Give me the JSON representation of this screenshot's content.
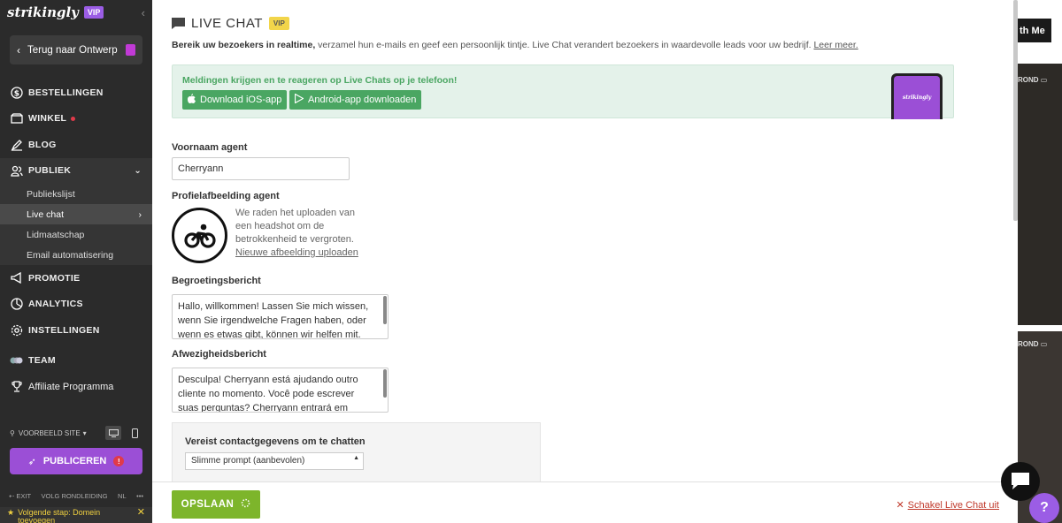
{
  "sidebar": {
    "logo": "strikingly",
    "vip_badge": "VIP",
    "back_button": "Terug naar Ontwerp",
    "nav": {
      "orders": "BESTELLINGEN",
      "store": "WINKEL",
      "blog": "BLOG",
      "audience": "PUBLIEK",
      "promotion": "PROMOTIE",
      "analytics": "ANALYTICS",
      "settings": "INSTELLINGEN",
      "team": "TEAM",
      "affiliate": "Affiliate Programma"
    },
    "audience_sub": {
      "list": "Publiekslijst",
      "live_chat": "Live chat",
      "membership": "Lidmaatschap",
      "email": "Email automatisering"
    },
    "preview_site": "VOORBEELD SITE",
    "publish": "PUBLICEREN",
    "exit": "EXIT",
    "tour": "VOLG RONDLEIDING",
    "lang": "NL",
    "more": "•••",
    "next_step": "Volgende stap: Domein toevoegen"
  },
  "panel": {
    "title": "LIVE CHAT",
    "vip_badge": "VIP",
    "intro_bold": "Bereik uw bezoekers in realtime,",
    "intro_rest": " verzamel hun e-mails en geef een persoonlijk tintje. Live Chat verandert bezoekers in waardevolle leads voor uw bedrijf. ",
    "learn_more": "Leer meer.",
    "phone_banner": {
      "message": "Meldingen krijgen en te reageren op Live Chats op je telefoon!",
      "ios_button": "Download iOS-app",
      "android_button": "Android-app downloaden",
      "phone_logo": "strikingly"
    },
    "agent_name_label": "Voornaam agent",
    "agent_name_value": "Cherryann",
    "profile_image_label": "Profielafbeelding agent",
    "profile_help": "We raden het uploaden van een headshot om de betrokkenheid te vergroten.",
    "upload_link": "Nieuwe afbeelding uploaden",
    "greeting_label": "Begroetingsbericht",
    "greeting_value": "Hallo, willkommen! Lassen Sie mich wissen, wenn Sie irgendwelche Fragen haben, oder wenn es etwas gibt, können wir helfen mit.",
    "away_label": "Afwezigheidsbericht",
    "away_value": "Desculpa! Cherryann está ajudando outro cliente no momento. Você pode escrever suas perguntas? Cherryann entrará em contato com você em breve.",
    "contact_label": "Vereist contactgegevens om te chatten",
    "contact_select": "Slimme prompt (aanbevolen)",
    "save_button": "OPSLAAN",
    "disable_link": "Schakel Live Chat uit"
  },
  "background": {
    "button_text": "th Me",
    "label1": "ROND",
    "label2": "ROND"
  },
  "colors": {
    "sidebar": "#2b2b2b",
    "accent_purple": "#9b4fd6",
    "green": "#4aa662",
    "save_green": "#7db52b",
    "danger": "#c0392b"
  }
}
